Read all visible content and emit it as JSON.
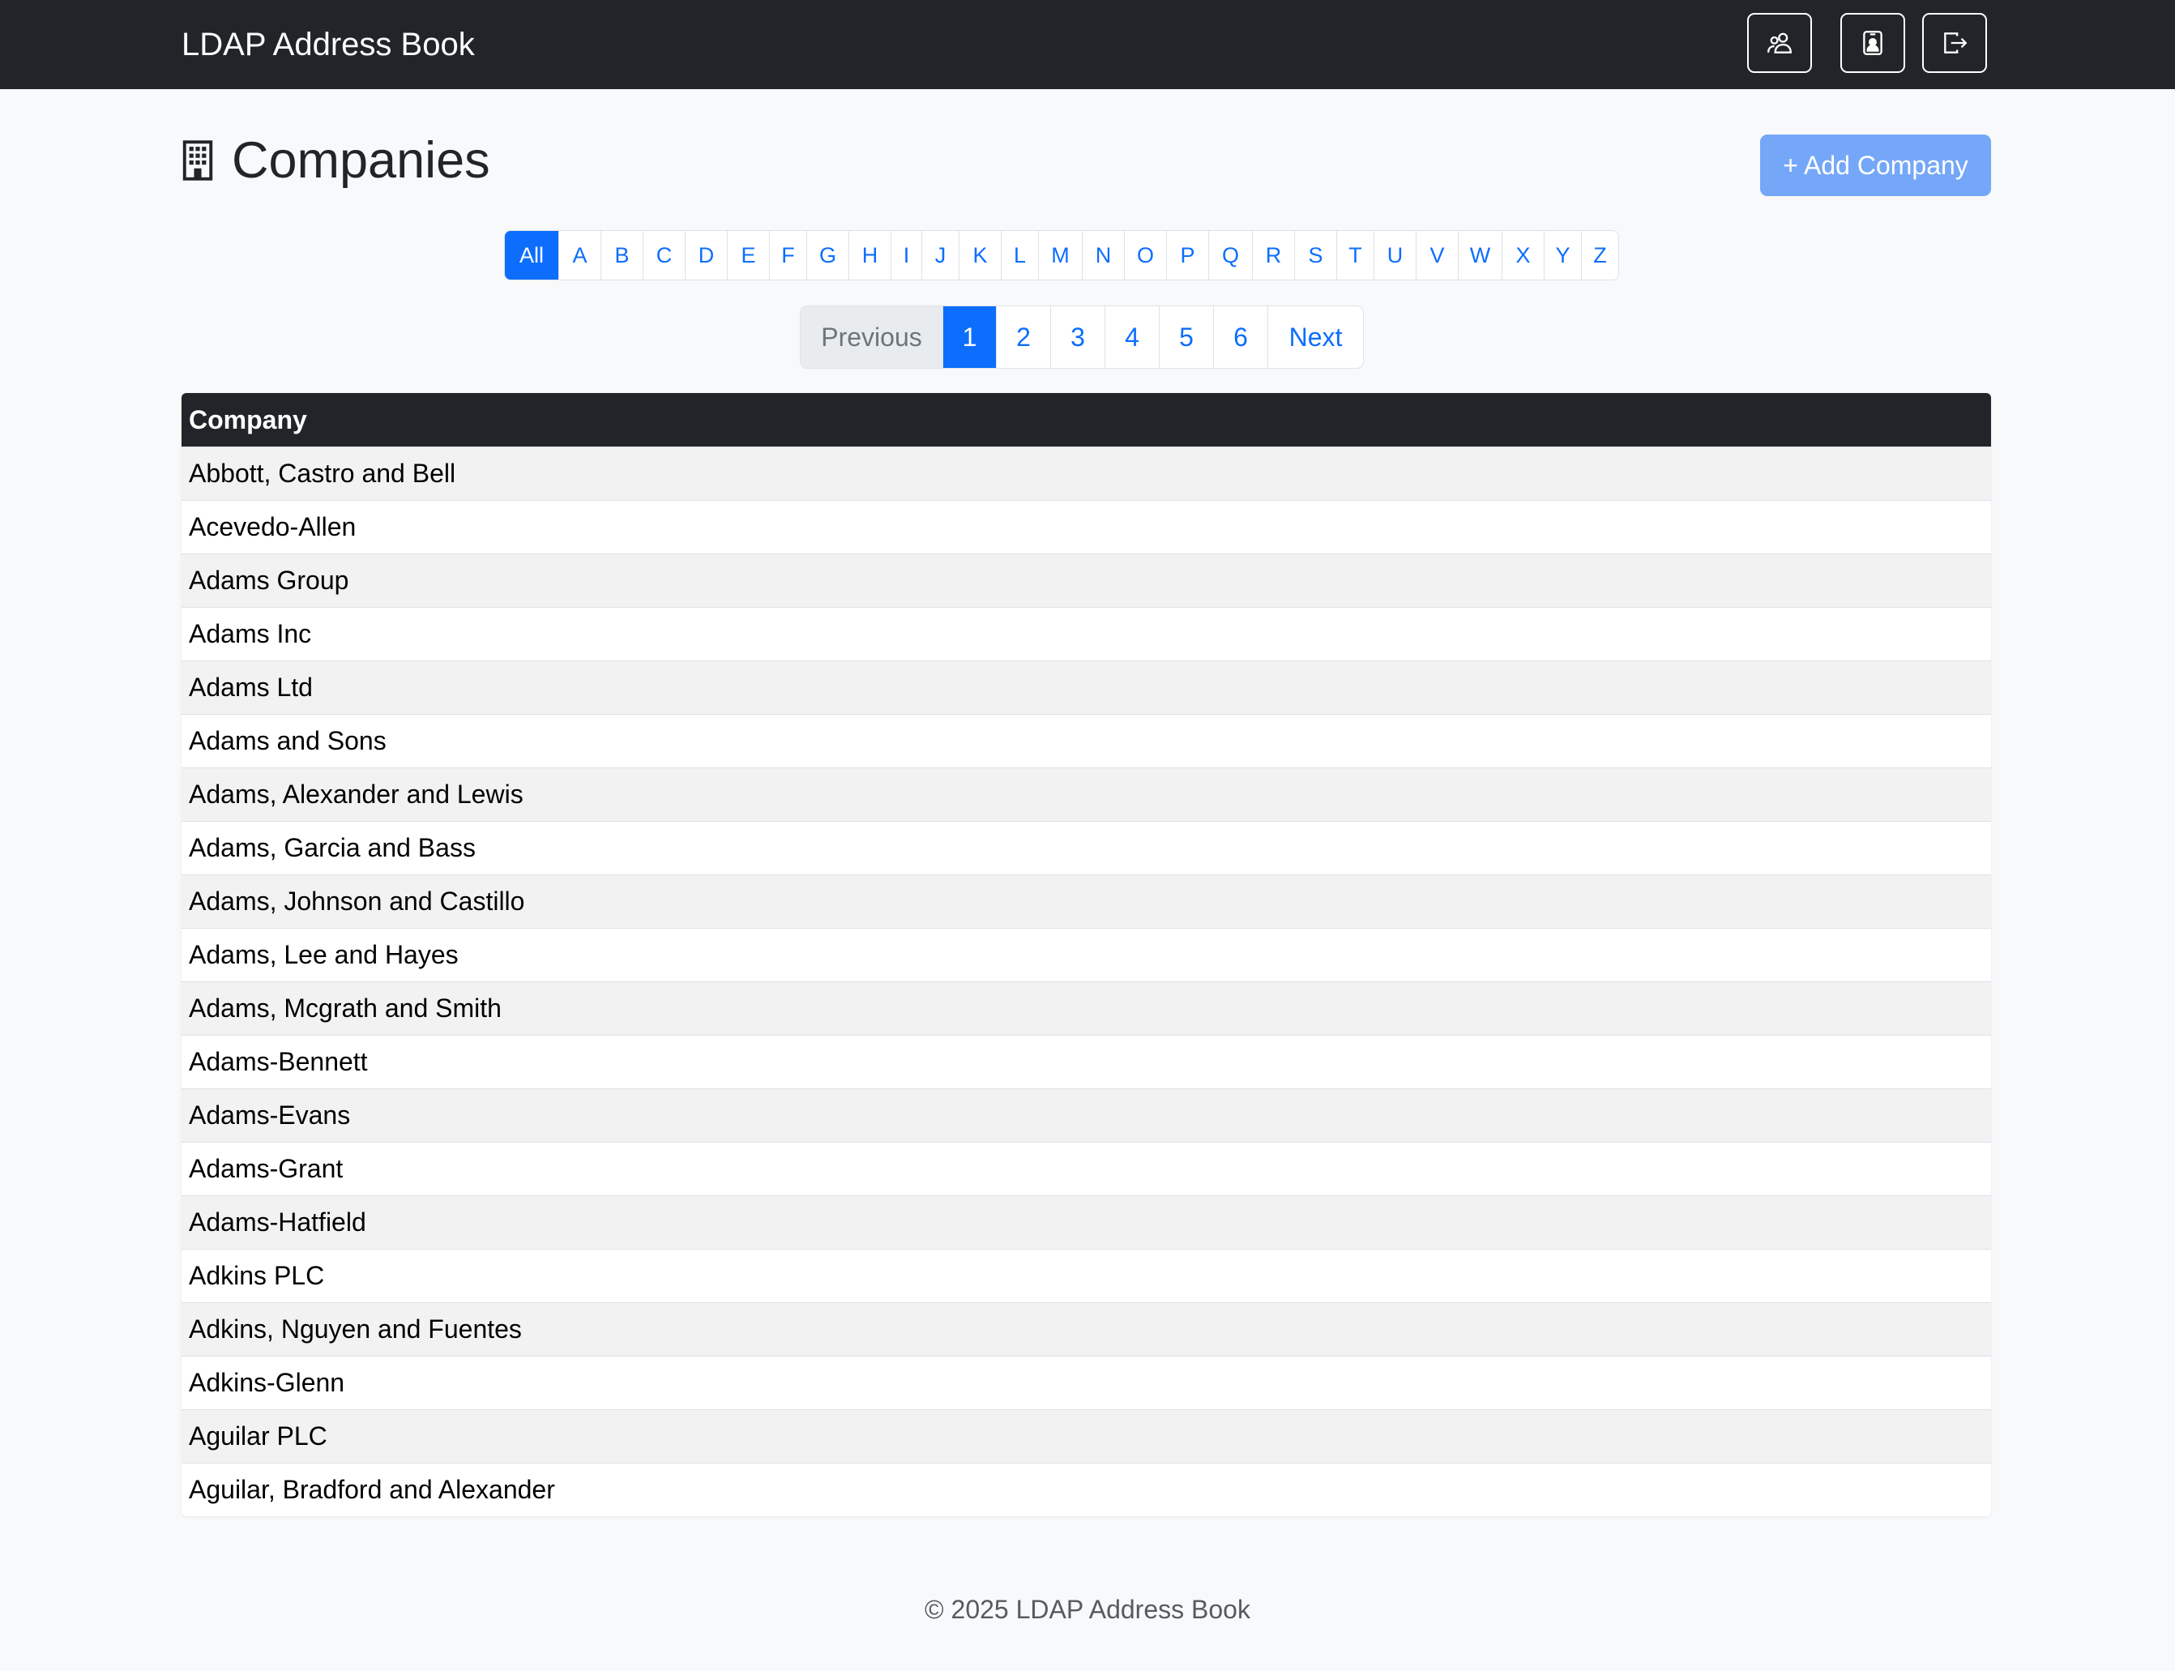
{
  "header": {
    "brand": "LDAP Address Book",
    "buttons": [
      {
        "icon": "people-icon"
      },
      {
        "icon": "contact-card-icon"
      },
      {
        "icon": "logout-icon"
      }
    ]
  },
  "page": {
    "icon": "building-icon",
    "title": "Companies",
    "add_button": "+ Add Company"
  },
  "alphabet": {
    "selected": "All",
    "letters": [
      "All",
      "A",
      "B",
      "C",
      "D",
      "E",
      "F",
      "G",
      "H",
      "I",
      "J",
      "K",
      "L",
      "M",
      "N",
      "O",
      "P",
      "Q",
      "R",
      "S",
      "T",
      "U",
      "V",
      "W",
      "X",
      "Y",
      "Z"
    ]
  },
  "pagination": {
    "previous": "Previous",
    "pages": [
      "1",
      "2",
      "3",
      "4",
      "5",
      "6"
    ],
    "current": "1",
    "next": "Next"
  },
  "table": {
    "header": "Company",
    "rows": [
      "Abbott, Castro and Bell",
      "Acevedo-Allen",
      "Adams Group",
      "Adams Inc",
      "Adams Ltd",
      "Adams and Sons",
      "Adams, Alexander and Lewis",
      "Adams, Garcia and Bass",
      "Adams, Johnson and Castillo",
      "Adams, Lee and Hayes",
      "Adams, Mcgrath and Smith",
      "Adams-Bennett",
      "Adams-Evans",
      "Adams-Grant",
      "Adams-Hatfield",
      "Adkins PLC",
      "Adkins, Nguyen and Fuentes",
      "Adkins-Glenn",
      "Aguilar PLC",
      "Aguilar, Bradford and Alexander"
    ]
  },
  "footer": "© 2025 LDAP Address Book",
  "colors": {
    "navbar": "#212529",
    "primary": "#0d6efd",
    "add_button": "#75a7f8"
  }
}
